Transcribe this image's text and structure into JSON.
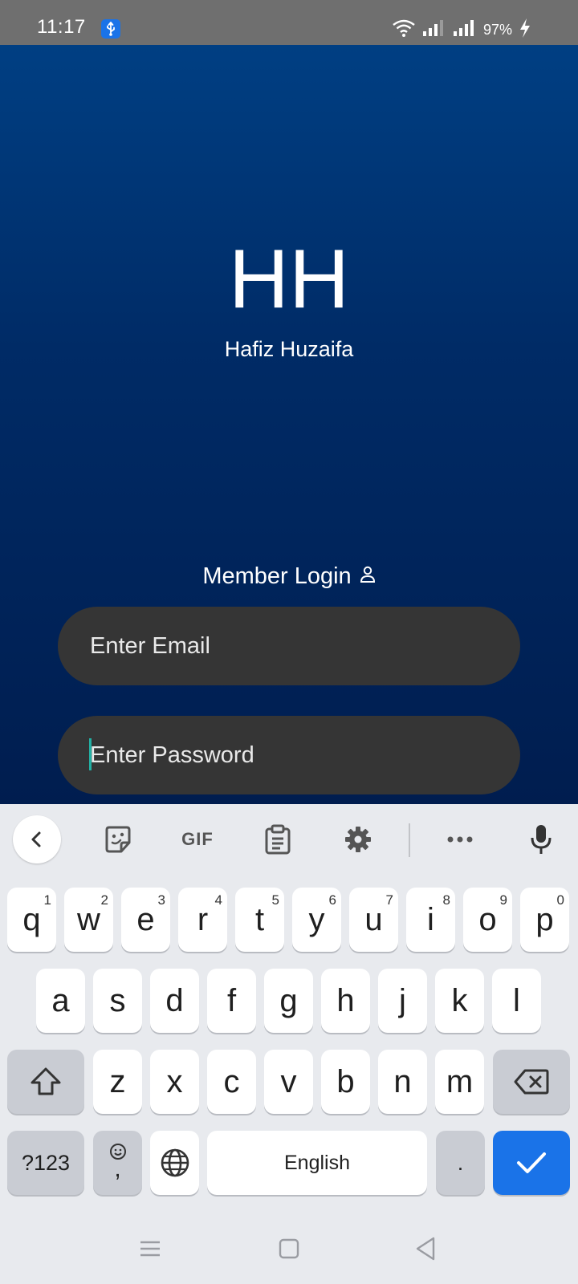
{
  "status_bar": {
    "time": "11:17",
    "battery": "97%"
  },
  "login": {
    "logo_initials": "HH",
    "logo_name": "Hafiz Huzaifa",
    "title": "Member Login",
    "email_placeholder": "Enter Email",
    "password_placeholder": "Enter Password"
  },
  "keyboard": {
    "toolbar": {
      "gif_label": "GIF"
    },
    "rows": [
      [
        {
          "label": "q",
          "hint": "1"
        },
        {
          "label": "w",
          "hint": "2"
        },
        {
          "label": "e",
          "hint": "3"
        },
        {
          "label": "r",
          "hint": "4"
        },
        {
          "label": "t",
          "hint": "5"
        },
        {
          "label": "y",
          "hint": "6"
        },
        {
          "label": "u",
          "hint": "7"
        },
        {
          "label": "i",
          "hint": "8"
        },
        {
          "label": "o",
          "hint": "9"
        },
        {
          "label": "p",
          "hint": "0"
        }
      ],
      [
        {
          "label": "a"
        },
        {
          "label": "s"
        },
        {
          "label": "d"
        },
        {
          "label": "f"
        },
        {
          "label": "g"
        },
        {
          "label": "h"
        },
        {
          "label": "j"
        },
        {
          "label": "k"
        },
        {
          "label": "l"
        }
      ],
      [
        {
          "label": "z"
        },
        {
          "label": "x"
        },
        {
          "label": "c"
        },
        {
          "label": "v"
        },
        {
          "label": "b"
        },
        {
          "label": "n"
        },
        {
          "label": "m"
        }
      ]
    ],
    "symbols_label": "?123",
    "comma_label": ",",
    "space_label": "English",
    "period_label": "."
  },
  "colors": {
    "accent": "#1a73e8",
    "login_bg_top": "#003f83",
    "login_bg_bottom": "#001d4f",
    "input_bg": "#353535",
    "caret": "#23b0a4"
  }
}
